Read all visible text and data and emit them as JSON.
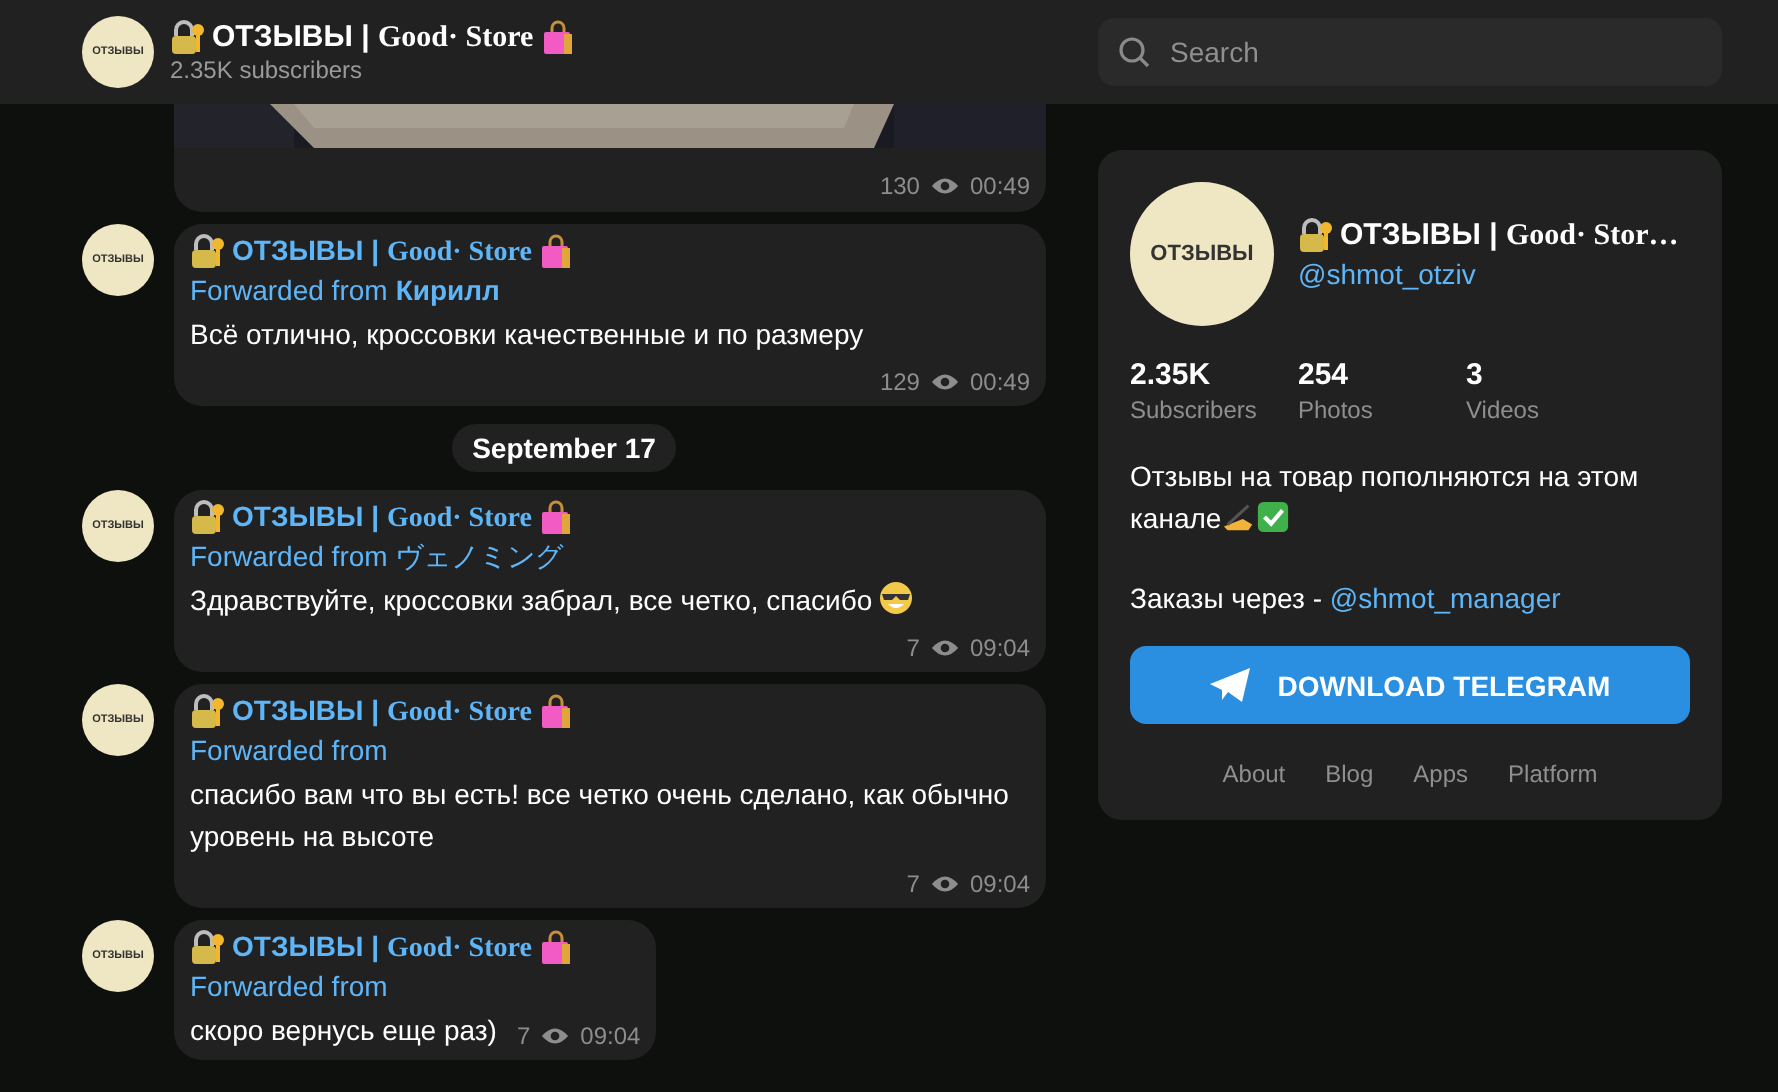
{
  "header": {
    "avatar_text": "ОТЗЫВЫ",
    "title": "ОТЗЫВЫ | **Good· Store**",
    "subscribers": "2.35K subscribers"
  },
  "search": {
    "placeholder": "Search"
  },
  "messages": [
    {
      "views": "130",
      "time": "00:49"
    },
    {
      "kind": "text",
      "avatar_text": "ОТЗЫВЫ",
      "author": "ОТЗЫВЫ | **Good· Store**",
      "forwarded_label": "Forwarded from",
      "forwarded_name": "Кирилл",
      "text": "Всё отлично, кроссовки качественные и по размеру",
      "views": "129",
      "time": "00:49"
    },
    {
      "kind": "date",
      "text": "September 17"
    },
    {
      "kind": "text",
      "avatar_text": "ОТЗЫВЫ",
      "author": "ОТЗЫВЫ | **Good· Store**",
      "forwarded_label": "Forwarded from ヴェノミング",
      "text": "Здравствуйте, кроссовки забрал, все четко, спасибо",
      "end_emoji": true,
      "views": "7",
      "time": "09:04"
    },
    {
      "kind": "text",
      "avatar_text": "ОТЗЫВЫ",
      "author": "ОТЗЫВЫ | **Good· Store**",
      "forwarded_label": "Forwarded from",
      "text": "спасибо вам что вы есть! все четко очень сделано, как обычно уровень на высоте",
      "views": "7",
      "time": "09:04"
    },
    {
      "kind": "text",
      "avatar_text": "ОТЗЫВЫ",
      "author": "ОТЗЫВЫ | **Good· Store**",
      "forwarded_label": "Forwarded from",
      "text": "скоро вернусь еще раз)",
      "views": "7",
      "time": "09:04"
    }
  ],
  "channel": {
    "avatar_text": "ОТЗЫВЫ",
    "title": "ОТЗЫВЫ | **Good· Stor…**",
    "username": "@shmot_otziv",
    "stats": [
      {
        "value": "2.35K",
        "label": "Subscribers"
      },
      {
        "value": "254",
        "label": "Photos"
      },
      {
        "value": "3",
        "label": "Videos"
      }
    ],
    "description_lines": [
      "Отзывы на товар пополняются на этом",
      "канале"
    ],
    "orders_text": "Заказы через -",
    "orders_link": "@shmot_manager",
    "button": "DOWNLOAD TELEGRAM",
    "links": [
      "About",
      "Blog",
      "Apps",
      "Platform"
    ]
  }
}
